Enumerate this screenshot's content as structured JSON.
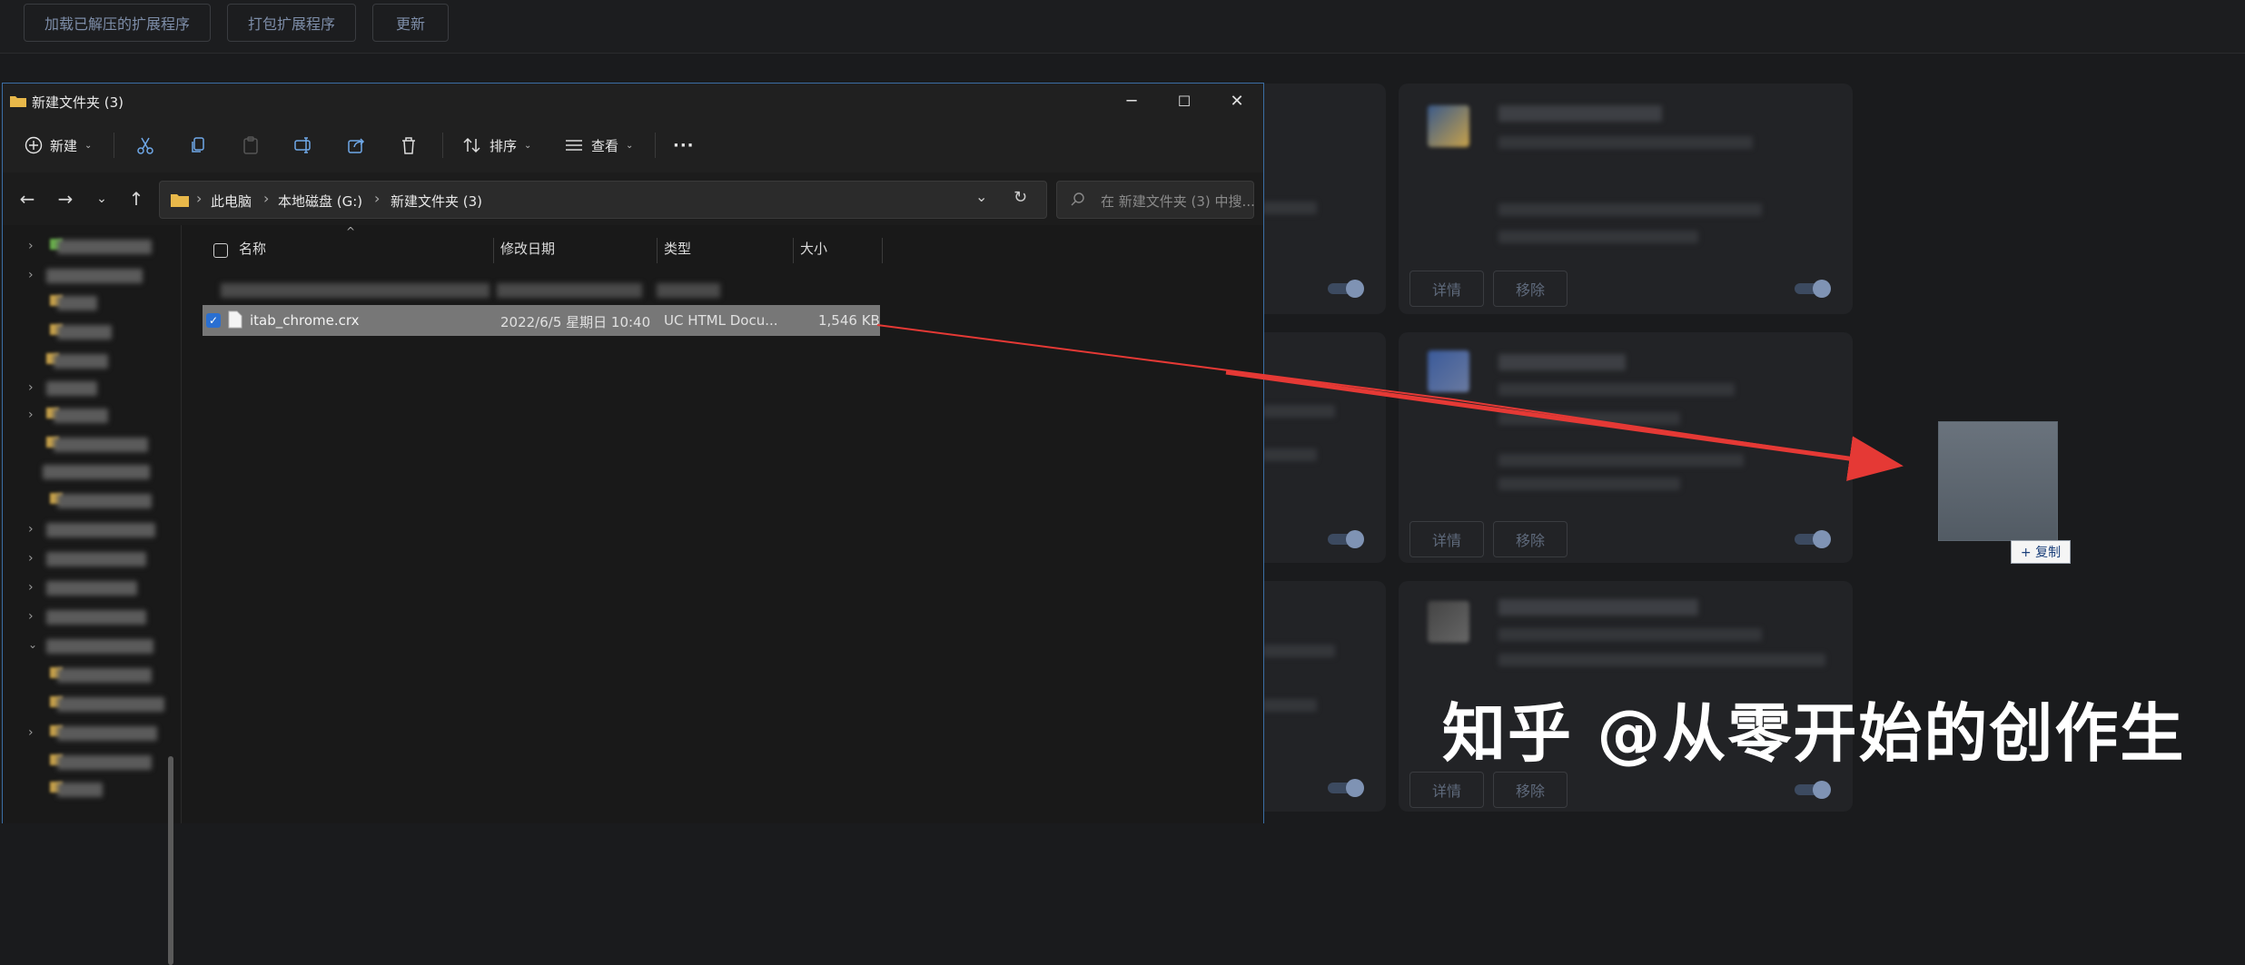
{
  "chrome_ext_page": {
    "toolbar": {
      "load_unpacked": "加载已解压的扩展程序",
      "pack_extension": "打包扩展程序",
      "update": "更新"
    },
    "card_buttons": {
      "details": "详情",
      "remove": "移除"
    }
  },
  "explorer": {
    "title": "新建文件夹 (3)",
    "window_controls": {
      "minimize": "─",
      "maximize": "☐",
      "close": "✕"
    },
    "command_bar": {
      "new": "新建",
      "sort": "排序",
      "view": "查看",
      "more": "···"
    },
    "address": {
      "crumbs": [
        "此电脑",
        "本地磁盘 (G:)",
        "新建文件夹 (3)"
      ]
    },
    "search_placeholder": "在 新建文件夹 (3) 中搜...",
    "columns": {
      "name": "名称",
      "modified": "修改日期",
      "type": "类型",
      "size": "大小"
    },
    "selected_file": {
      "name": "itab_chrome.crx",
      "modified": "2022/6/5 星期日 10:40",
      "type": "UC HTML Docu...",
      "size": "1,546 KB"
    }
  },
  "drag": {
    "copy_badge": "+ 复制"
  },
  "watermark": "知乎 @从零开始的创作生",
  "colors": {
    "accent_border": "#3b6ea5",
    "arrow": "#e53935",
    "selected_row": "#777777",
    "folder": "#e8b84a"
  }
}
